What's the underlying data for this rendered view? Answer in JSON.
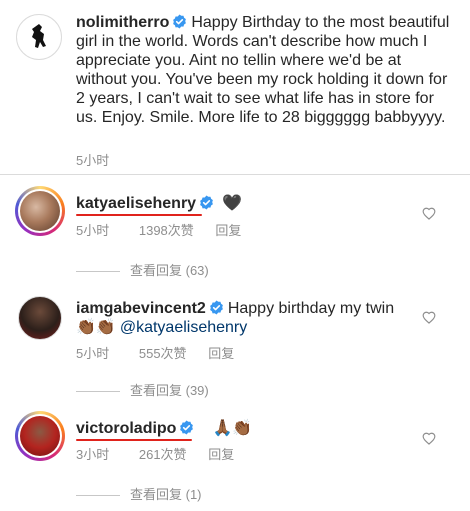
{
  "post": {
    "username": "nolimitherro",
    "caption": "Happy Birthday to the most beautiful girl in the world. Words can't describe how much I appreciate you. Aint no tellin where we'd be at without you. You've been my rock holding it down for 2 years, I can't wait to see what life has in store for us. Enjoy. Smile. More life to 28 bigggggg babbyyyy.",
    "time": "5小时"
  },
  "comments": [
    {
      "username": "katyaelisehenry",
      "text": "🖤",
      "time": "5小时",
      "likes": "1398次赞",
      "reply_label": "回复",
      "view_replies": "查看回复 (63)"
    },
    {
      "username": "iamgabevincent2",
      "text": "Happy birthday my twin",
      "emoji": "👏🏾👏🏾",
      "mention": "@katyaelisehenry",
      "time": "5小时",
      "likes": "555次赞",
      "reply_label": "回复",
      "view_replies": "查看回复 (39)"
    },
    {
      "username": "victoroladipo",
      "text": "🙏🏾👏🏾",
      "time": "3小时",
      "likes": "261次赞",
      "reply_label": "回复",
      "view_replies": "查看回复 (1)"
    }
  ],
  "colors": {
    "verified": "#3897f0",
    "annotation": "#e0231c",
    "muted": "#8e8e8e"
  }
}
